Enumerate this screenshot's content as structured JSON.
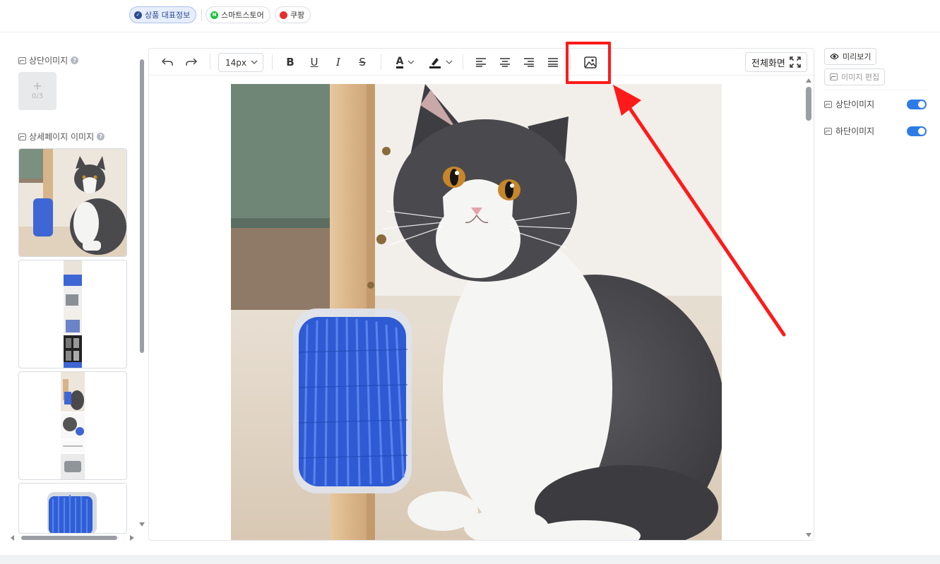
{
  "tabs": [
    {
      "label": "상품 대표정보",
      "active": true,
      "icon": "check-circle-icon",
      "color": "#2c4c91"
    },
    {
      "label": "스마트스토어",
      "active": false,
      "icon": "naver-n-icon",
      "color": "#19c23a"
    },
    {
      "label": "쿠팡",
      "active": false,
      "icon": "coupang-icon",
      "color": "#e62e2e"
    }
  ],
  "left_panel": {
    "top_images": {
      "title": "상단이미지",
      "upload_count": "0/3"
    },
    "detail_images": {
      "title": "상세페이지 이미지",
      "thumb_count": 4
    }
  },
  "editor": {
    "toolbar": {
      "undo": "undo-icon",
      "redo": "redo-icon",
      "font_size": "14px",
      "bold": "B",
      "underline": "U",
      "italic": "I",
      "strike": "S",
      "text_color": "A",
      "fullscreen_label": "전체화면"
    },
    "content_image": "cat-with-wall-brush-photo"
  },
  "right_panel": {
    "preview_label": "미리보기",
    "edit_image_label": "이미지 편집",
    "toggles": [
      {
        "label": "상단이미지",
        "on": true
      },
      {
        "label": "하단이미지",
        "on": true
      }
    ]
  },
  "colors": {
    "accent": "#2f7be6",
    "highlight": "#ff1a1a"
  }
}
